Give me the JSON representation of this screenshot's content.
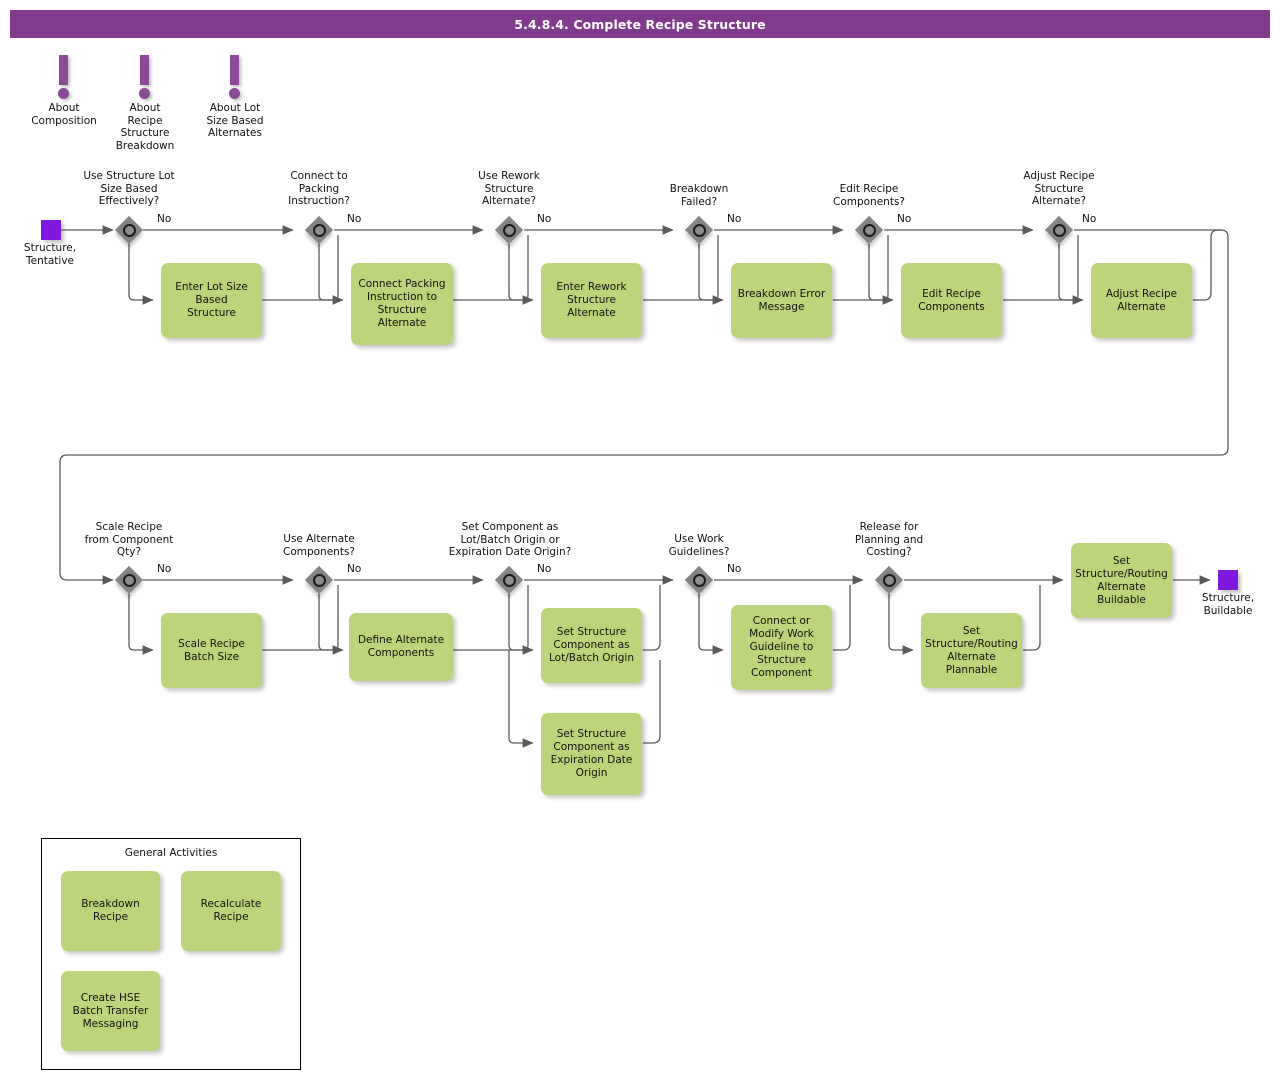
{
  "header": {
    "title": "5.4.8.4. Complete Recipe Structure",
    "bar_color": "#803b8c"
  },
  "colors": {
    "task_green": "#bdd47a",
    "event_purple": "#7f18e0",
    "gateway_gray": "#848484",
    "note_purple": "#8a4a95",
    "connector": "#5a5a5a"
  },
  "notes": [
    {
      "icon": "exclamation-icon",
      "label": "About\nComposition"
    },
    {
      "icon": "exclamation-icon",
      "label": "About\nRecipe\nStructure\nBreakdown"
    },
    {
      "icon": "exclamation-icon",
      "label": "About Lot\nSize Based\nAlternates"
    }
  ],
  "events": {
    "start": {
      "label": "Structure,\nTentative"
    },
    "end": {
      "label": "Structure,\nBuildable"
    }
  },
  "branch_label": "No",
  "gateways": [
    {
      "id": "gw1",
      "label": "Use Structure Lot\nSize Based\nEffectively?"
    },
    {
      "id": "gw2",
      "label": "Connect to\nPacking\nInstruction?"
    },
    {
      "id": "gw3",
      "label": "Use Rework\nStructure\nAlternate?"
    },
    {
      "id": "gw4",
      "label": "Breakdown\nFailed?"
    },
    {
      "id": "gw5",
      "label": "Edit Recipe\nComponents?"
    },
    {
      "id": "gw6",
      "label": "Adjust Recipe\nStructure\nAlternate?"
    },
    {
      "id": "gw7",
      "label": "Scale Recipe\nfrom Component\nQty?"
    },
    {
      "id": "gw8",
      "label": "Use Alternate\nComponents?"
    },
    {
      "id": "gw9",
      "label": "Set Component as\nLot/Batch Origin or\nExpiration Date Origin?"
    },
    {
      "id": "gw10",
      "label": "Use Work\nGuidelines?"
    },
    {
      "id": "gw11",
      "label": "Release for\nPlanning and\nCosting?"
    }
  ],
  "tasks": [
    {
      "id": "t1",
      "label": "Enter Lot Size\nBased\nStructure"
    },
    {
      "id": "t2",
      "label": "Connect Packing\nInstruction to\nStructure\nAlternate"
    },
    {
      "id": "t3",
      "label": "Enter Rework\nStructure\nAlternate"
    },
    {
      "id": "t4",
      "label": "Breakdown Error\nMessage"
    },
    {
      "id": "t5",
      "label": "Edit Recipe\nComponents"
    },
    {
      "id": "t6",
      "label": "Adjust Recipe\nAlternate"
    },
    {
      "id": "t7",
      "label": "Scale Recipe\nBatch Size"
    },
    {
      "id": "t8",
      "label": "Define Alternate\nComponents"
    },
    {
      "id": "t9",
      "label": "Set Structure\nComponent as\nLot/Batch Origin"
    },
    {
      "id": "t10",
      "label": "Set Structure\nComponent as\nExpiration Date\nOrigin"
    },
    {
      "id": "t11",
      "label": "Connect or\nModify Work\nGuideline to\nStructure\nComponent"
    },
    {
      "id": "t12",
      "label": "Set\nStructure/Routing\nAlternate\nPlannable"
    },
    {
      "id": "t13",
      "label": "Set\nStructure/Routing\nAlternate\nBuildable"
    }
  ],
  "general_activities": {
    "title": "General Activities",
    "items": [
      {
        "id": "ga1",
        "label": "Breakdown\nRecipe"
      },
      {
        "id": "ga2",
        "label": "Recalculate\nRecipe"
      },
      {
        "id": "ga3",
        "label": "Create HSE\nBatch Transfer\nMessaging"
      }
    ]
  }
}
